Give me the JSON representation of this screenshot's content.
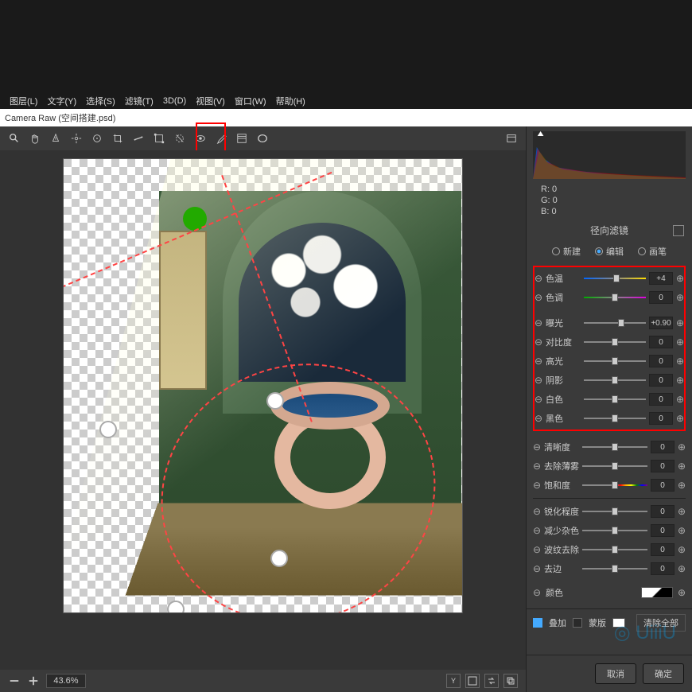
{
  "menubar": [
    "图层(L)",
    "文字(Y)",
    "选择(S)",
    "滤镜(T)",
    "3D(D)",
    "视图(V)",
    "窗口(W)",
    "帮助(H)"
  ],
  "title": "Camera Raw (空间搭建.psd)",
  "zoom": "43.6%",
  "rgb": {
    "r": "R:      0",
    "g": "G:      0",
    "b": "B:      0"
  },
  "panel_title": "径向滤镜",
  "modes": {
    "new": "新建",
    "edit": "编辑",
    "brush": "画笔"
  },
  "sliders": {
    "temp": {
      "label": "色温",
      "val": "+4",
      "pos": 53
    },
    "tint": {
      "label": "色调",
      "val": "0",
      "pos": 50
    },
    "exposure": {
      "label": "曝光",
      "val": "+0.90",
      "pos": 60
    },
    "contrast": {
      "label": "对比度",
      "val": "0",
      "pos": 50
    },
    "highlights": {
      "label": "高光",
      "val": "0",
      "pos": 50
    },
    "shadows": {
      "label": "阴影",
      "val": "0",
      "pos": 50
    },
    "whites": {
      "label": "白色",
      "val": "0",
      "pos": 50
    },
    "blacks": {
      "label": "黑色",
      "val": "0",
      "pos": 50
    },
    "clarity": {
      "label": "清晰度",
      "val": "0",
      "pos": 50
    },
    "dehaze": {
      "label": "去除薄雾",
      "val": "0",
      "pos": 50
    },
    "saturation": {
      "label": "饱和度",
      "val": "0",
      "pos": 50
    },
    "sharpness": {
      "label": "锐化程度",
      "val": "0",
      "pos": 50
    },
    "noise": {
      "label": "减少杂色",
      "val": "0",
      "pos": 50
    },
    "moire": {
      "label": "波纹去除",
      "val": "0",
      "pos": 50
    },
    "defringe": {
      "label": "去边",
      "val": "0",
      "pos": 50
    }
  },
  "color_label": "颜色",
  "overlay": {
    "label": "叠加",
    "mask": "蒙版",
    "clear": "清除全部"
  },
  "buttons": {
    "cancel": "取消",
    "ok": "确定"
  },
  "bottombar": {
    "y": "Y"
  }
}
